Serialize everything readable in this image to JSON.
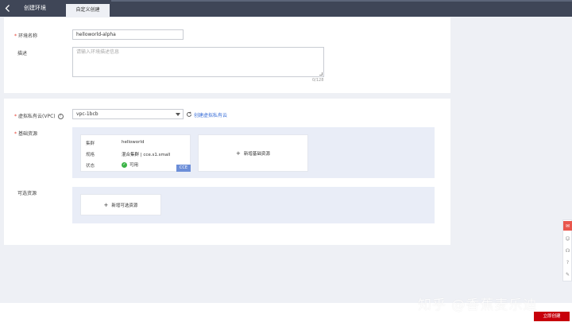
{
  "header": {
    "title": "创建环境",
    "active_tab": "自定义创建"
  },
  "form": {
    "env_name": {
      "label": "环境名称",
      "value": "helloworld-alpha"
    },
    "description": {
      "label": "描述",
      "placeholder": "请输入环境描述信息",
      "counter": "0/128"
    },
    "vpc": {
      "label": "虚拟私有云(VPC)",
      "value": "vpc-1bcb",
      "create_link": "创建虚拟私有云"
    },
    "base_resources": {
      "label": "基础资源",
      "cluster": {
        "cluster_label": "集群",
        "cluster_value": "helloworld",
        "spec_label": "规格",
        "spec_value": "混合集群 | cce.s1.small",
        "status_label": "状态",
        "status_value": "可用",
        "badge": "CCE"
      },
      "add_button": "新增基础资源"
    },
    "optional_resources": {
      "label": "可选资源",
      "add_button": "新增可选资源"
    }
  },
  "footer": {
    "submit_label": "立即创建"
  },
  "watermark": "知乎 @香蕉麦乐迪",
  "colors": {
    "topbar": "#3f4657",
    "primary_link": "#3a6fd8",
    "submit": "#c7000b",
    "panel_bg": "#e9edf7",
    "status_ok": "#3bb346"
  }
}
